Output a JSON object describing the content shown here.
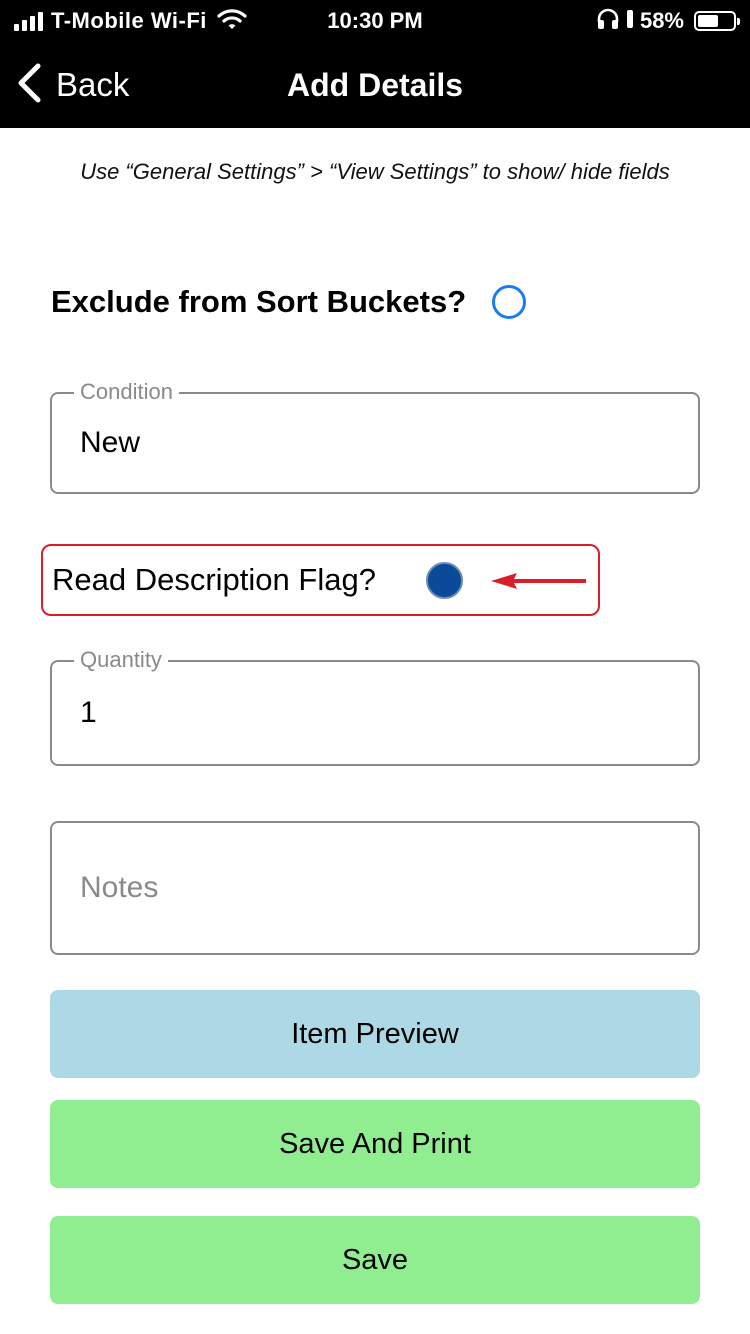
{
  "status_bar": {
    "carrier": "T-Mobile Wi-Fi",
    "time": "10:30 PM",
    "battery_percent": "58%",
    "battery_level": 0.58,
    "signal_bars": 4
  },
  "nav": {
    "back_label": "Back",
    "title": "Add Details"
  },
  "hint_text": "Use “General Settings” > “View Settings” to show/ hide fields",
  "exclude_sort_buckets": {
    "label": "Exclude from Sort Buckets?",
    "selected": false
  },
  "condition": {
    "label": "Condition",
    "value": "New"
  },
  "read_description_flag": {
    "label": "Read Description Flag?",
    "selected": true,
    "highlight_color": "#d81e2a"
  },
  "quantity": {
    "label": "Quantity",
    "value": "1"
  },
  "notes": {
    "placeholder": "Notes"
  },
  "buttons": {
    "item_preview": "Item Preview",
    "save_and_print": "Save And Print",
    "save": "Save"
  },
  "colors": {
    "preview_button": "#add8e6",
    "save_buttons": "#90ee90",
    "radio_selected": "#0a4a99",
    "radio_unselected": "#1a7cf0"
  }
}
